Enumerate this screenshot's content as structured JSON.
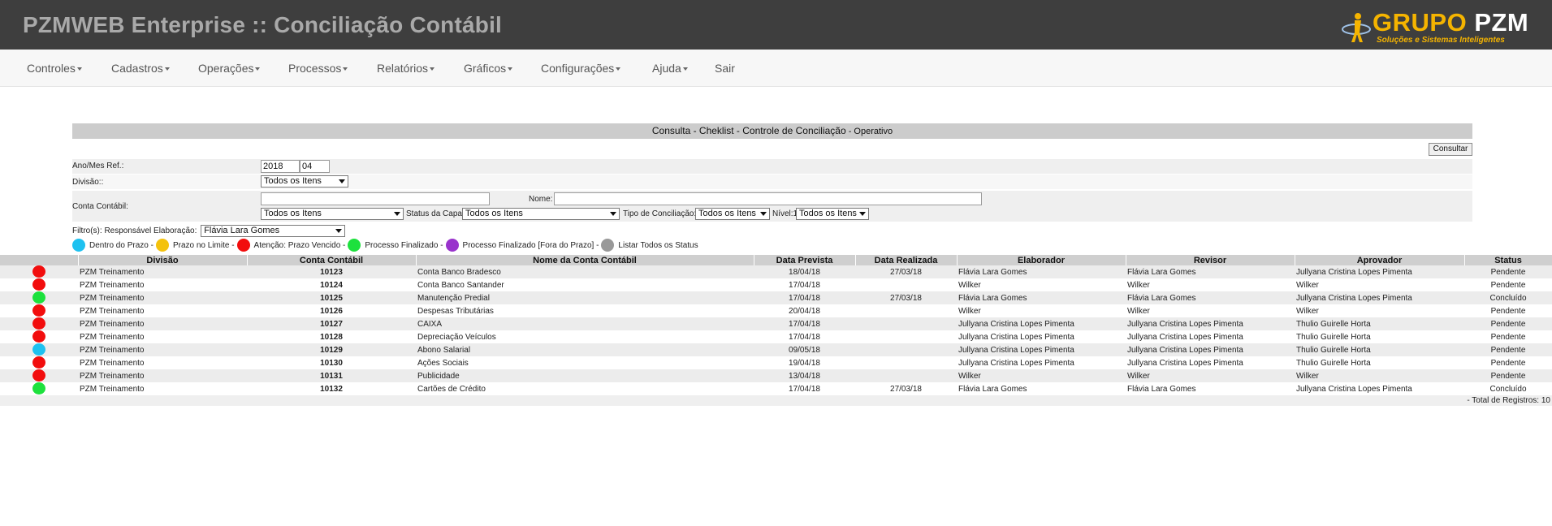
{
  "app": {
    "title": "PZMWEB Enterprise :: Conciliação Contábil",
    "logo_word_1": "GRUPO",
    "logo_word_2": "PZM",
    "logo_tagline": "Soluções e Sistemas Inteligentes"
  },
  "nav": {
    "items": [
      {
        "label": "Controles",
        "has_menu": true
      },
      {
        "label": "Cadastros",
        "has_menu": true
      },
      {
        "label": "Operações",
        "has_menu": true
      },
      {
        "label": "Processos",
        "has_menu": true
      },
      {
        "label": "Relatórios",
        "has_menu": true
      },
      {
        "label": "Gráficos",
        "has_menu": true
      },
      {
        "label": "Configurações",
        "has_menu": true
      },
      {
        "label": "Ajuda",
        "has_menu": true
      },
      {
        "label": "Sair",
        "has_menu": false
      }
    ]
  },
  "form": {
    "title": "Consulta - Cheklist - Controle de Conciliação",
    "title_sub": " - Operativo",
    "consult_button": "Consultar",
    "year_month_label": "Ano/Mes Ref.:",
    "year_value": "2018",
    "month_value": "04",
    "division_label": "Divisão::",
    "division_value": "Todos os Itens",
    "account_label": "Conta Contábil:",
    "account_value": "",
    "name_label": "Nome:",
    "name_value": "",
    "account_select_value": "Todos os Itens",
    "capa_status_label": "Status da Capa:",
    "capa_status_value": "Todos os Itens",
    "conciliation_type_label": "Tipo de Conciliação:",
    "conciliation_type_value": "Todos os Itens",
    "level_label": "Nível:1",
    "level_value": "Todos os Itens"
  },
  "filter": {
    "label": "Filtro(s): Responsável Elaboração:",
    "value": "Flávia Lara Gomes"
  },
  "legend": [
    {
      "label": "Dentro do Prazo -",
      "color": "#1ec1f0"
    },
    {
      "label": "Prazo no Limite -",
      "color": "#f4c20d"
    },
    {
      "label": "Atenção: Prazo Vencido -",
      "color": "#f20d0d"
    },
    {
      "label": "Processo Finalizado -",
      "color": "#1de13d"
    },
    {
      "label": "Processo Finalizado [Fora do Prazo] -",
      "color": "#9933cc"
    },
    {
      "label": "Listar Todos os Status",
      "color": "#999999"
    }
  ],
  "table": {
    "columns": [
      "",
      "Divisão",
      "Conta Contábil",
      "Nome da Conta Contábil",
      "Data Prevista",
      "Data Realizada",
      "Elaborador",
      "Revisor",
      "Aprovador",
      "Status"
    ],
    "rows": [
      {
        "status_color": "#f20d0d",
        "division": "PZM Treinamento",
        "account": "10123",
        "account_name": "Conta Banco Bradesco",
        "planned": "18/04/18",
        "done": "27/03/18",
        "preparer": "Flávia Lara Gomes",
        "reviewer": "Flávia Lara Gomes",
        "approver": "Jullyana Cristina Lopes Pimenta",
        "status": "Pendente"
      },
      {
        "status_color": "#f20d0d",
        "division": "PZM Treinamento",
        "account": "10124",
        "account_name": "Conta Banco Santander",
        "planned": "17/04/18",
        "done": "",
        "preparer": "Wilker",
        "reviewer": "Wilker",
        "approver": "Wilker",
        "status": "Pendente"
      },
      {
        "status_color": "#1de13d",
        "division": "PZM Treinamento",
        "account": "10125",
        "account_name": "Manutenção Predial",
        "planned": "17/04/18",
        "done": "27/03/18",
        "preparer": "Flávia Lara Gomes",
        "reviewer": "Flávia Lara Gomes",
        "approver": "Jullyana Cristina Lopes Pimenta",
        "status": "Concluído"
      },
      {
        "status_color": "#f20d0d",
        "division": "PZM Treinamento",
        "account": "10126",
        "account_name": "Despesas Tributárias",
        "planned": "20/04/18",
        "done": "",
        "preparer": "Wilker",
        "reviewer": "Wilker",
        "approver": "Wilker",
        "status": "Pendente"
      },
      {
        "status_color": "#f20d0d",
        "division": "PZM Treinamento",
        "account": "10127",
        "account_name": "CAIXA",
        "planned": "17/04/18",
        "done": "",
        "preparer": "Jullyana Cristina Lopes Pimenta",
        "reviewer": "Jullyana Cristina Lopes Pimenta",
        "approver": "Thulio Guirelle Horta",
        "status": "Pendente"
      },
      {
        "status_color": "#f20d0d",
        "division": "PZM Treinamento",
        "account": "10128",
        "account_name": "Depreciação Veículos",
        "planned": "17/04/18",
        "done": "",
        "preparer": "Jullyana Cristina Lopes Pimenta",
        "reviewer": "Jullyana Cristina Lopes Pimenta",
        "approver": "Thulio Guirelle Horta",
        "status": "Pendente"
      },
      {
        "status_color": "#1ec1f0",
        "division": "PZM Treinamento",
        "account": "10129",
        "account_name": "Abono Salarial",
        "planned": "09/05/18",
        "done": "",
        "preparer": "Jullyana Cristina Lopes Pimenta",
        "reviewer": "Jullyana Cristina Lopes Pimenta",
        "approver": "Thulio Guirelle Horta",
        "status": "Pendente"
      },
      {
        "status_color": "#f20d0d",
        "division": "PZM Treinamento",
        "account": "10130",
        "account_name": "Ações Sociais",
        "planned": "19/04/18",
        "done": "",
        "preparer": "Jullyana Cristina Lopes Pimenta",
        "reviewer": "Jullyana Cristina Lopes Pimenta",
        "approver": "Thulio Guirelle Horta",
        "status": "Pendente"
      },
      {
        "status_color": "#f20d0d",
        "division": "PZM Treinamento",
        "account": "10131",
        "account_name": "Publicidade",
        "planned": "13/04/18",
        "done": "",
        "preparer": "Wilker",
        "reviewer": "Wilker",
        "approver": "Wilker",
        "status": "Pendente"
      },
      {
        "status_color": "#1de13d",
        "division": "PZM Treinamento",
        "account": "10132",
        "account_name": "Cartões de Crédito",
        "planned": "17/04/18",
        "done": "27/03/18",
        "preparer": "Flávia Lara Gomes",
        "reviewer": "Flávia Lara Gomes",
        "approver": "Jullyana Cristina Lopes Pimenta",
        "status": "Concluído"
      }
    ],
    "footer": "- Total de Registros: 10"
  }
}
